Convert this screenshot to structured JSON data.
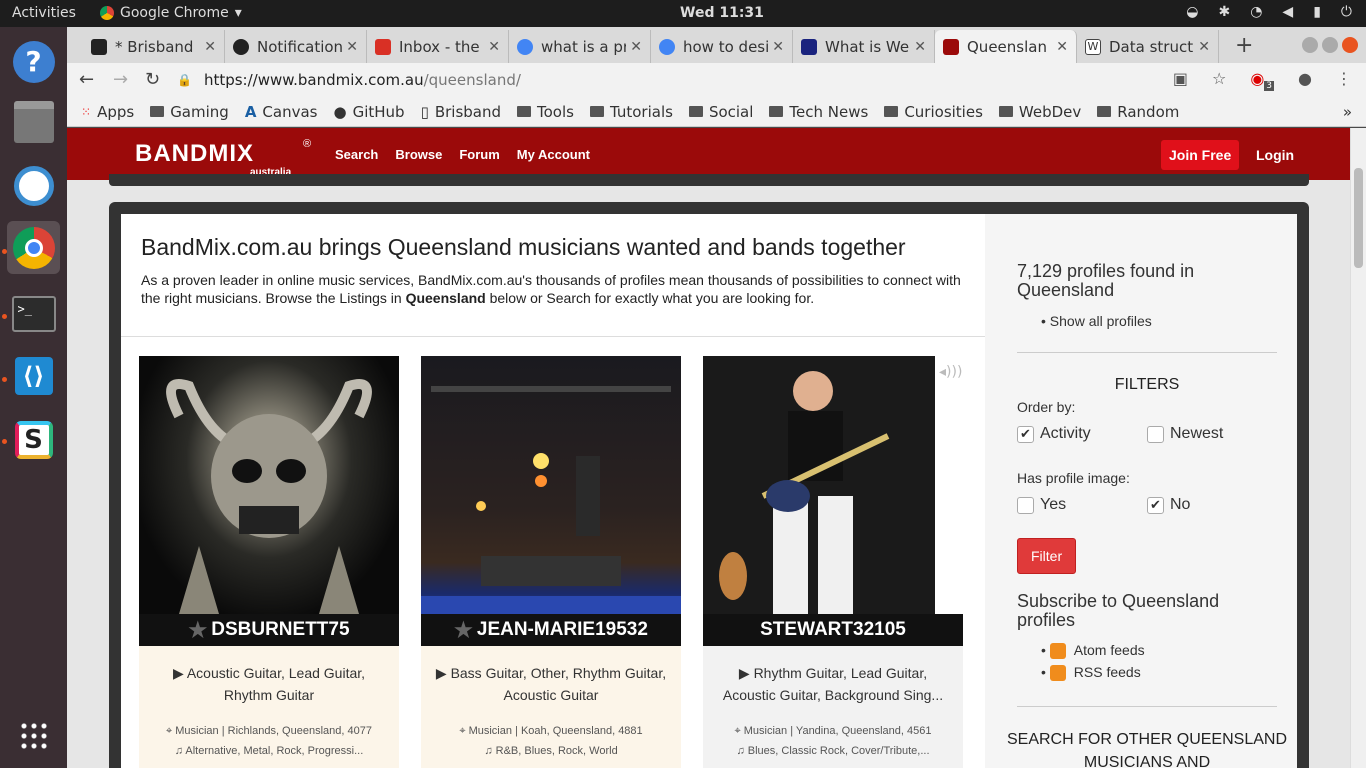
{
  "topbar": {
    "activities": "Activities",
    "app_name": "Google Chrome",
    "clock": "Wed 11:31"
  },
  "tabs": [
    {
      "title": "* Brisband",
      "color": "#222"
    },
    {
      "title": "Notification",
      "color": "#222"
    },
    {
      "title": "Inbox - the",
      "color": "#d93025"
    },
    {
      "title": "what is a pr",
      "color": "#4285f4"
    },
    {
      "title": "how to desi",
      "color": "#4285f4"
    },
    {
      "title": "What is We",
      "color": "#1a237e"
    },
    {
      "title": "Queenslan",
      "color": "#9b0a0a"
    },
    {
      "title": "Data struct",
      "color": "#222"
    }
  ],
  "address": {
    "domain": "https://www.bandmix.com.au",
    "path": "/queensland/",
    "notif_count": "3"
  },
  "bookmarks": [
    "Apps",
    "Gaming",
    "Canvas",
    "GitHub",
    "Brisband",
    "Tools",
    "Tutorials",
    "Social",
    "Tech News",
    "Curiosities",
    "WebDev",
    "Random"
  ],
  "site": {
    "logo": "BANDMIX",
    "logo_sub": "australia",
    "logo_mark": "®",
    "nav": [
      "Search",
      "Browse",
      "Forum",
      "My Account"
    ],
    "join": "Join Free",
    "login": "Login",
    "heading": "BandMix.com.au brings Queensland musicians wanted and bands together",
    "intro_a": "As a proven leader in online music services, BandMix.com.au's thousands of profiles mean thousands of possibilities to connect with the right musicians. Browse the Listings in ",
    "intro_bold": "Queensland",
    "intro_b": " below or Search for exactly what you are looking for."
  },
  "cards": [
    {
      "name": "DSBURNETT75",
      "instruments": "Acoustic Guitar, Lead Guitar, Rhythm Guitar",
      "location": "Musician | Richlands, Queensland, 4077",
      "genres": "Alternative, Metal, Rock, Progressi..."
    },
    {
      "name": "JEAN-MARIE19532",
      "instruments": "Bass Guitar, Other, Rhythm Guitar, Acoustic Guitar",
      "location": "Musician | Koah, Queensland, 4881",
      "genres": "R&B, Blues, Rock, World"
    },
    {
      "name": "STEWART32105",
      "instruments": "Rhythm Guitar, Lead Guitar, Acoustic Guitar, Background Sing...",
      "location": "Musician | Yandina, Queensland, 4561",
      "genres": "Blues, Classic Rock, Cover/Tribute,..."
    }
  ],
  "sidebar": {
    "count": "7,129 profiles found in Queensland",
    "show_all": "Show all profiles",
    "filters": "FILTERS",
    "order_by": "Order by:",
    "activity": "Activity",
    "newest": "Newest",
    "has_image": "Has profile image:",
    "yes": "Yes",
    "no": "No",
    "filter_btn": "Filter",
    "subscribe": "Subscribe to Queensland profiles",
    "atom": "Atom feeds",
    "rss": "RSS feeds",
    "search_other": "SEARCH FOR OTHER QUEENSLAND MUSICIANS AND"
  }
}
